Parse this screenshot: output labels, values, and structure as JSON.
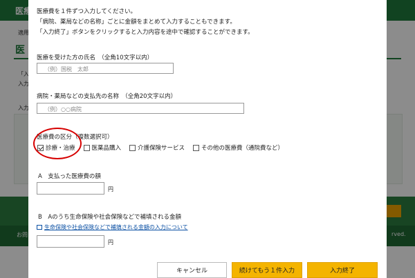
{
  "background": {
    "header_title": "医療",
    "line1": "適用",
    "title": "医",
    "text1": "「入",
    "text2": "入力",
    "text3": "入力",
    "footer_left": "お問",
    "footer_right": "rved."
  },
  "modal": {
    "intro": [
      "医療費を１件ずつ入力してください。",
      "「病院、薬局などの名称」ごとに金額をまとめて入力することもできます。",
      "「入力終了」ボタンをクリックすると入力内容を途中で確認することができます。"
    ],
    "name_label": "医療を受けた方の氏名　（全角10文字以内）",
    "name_placeholder": "（例）国税　太郎",
    "payee_label": "病院・薬局などの支払先の名称　（全角20文字以内）",
    "payee_placeholder": "（例）○○病院",
    "category_label": "医療費の区分（複数選択可）",
    "categories": [
      {
        "label": "診療・治療",
        "checked": true
      },
      {
        "label": "医薬品購入",
        "checked": false
      },
      {
        "label": "介護保険サービス",
        "checked": false
      },
      {
        "label": "その他の医療費（通院費など）",
        "checked": false
      }
    ],
    "amount_a_label": "A　支払った医療費の額",
    "amount_a_unit": "円",
    "amount_b_label": "B　Aのうち生命保険や社会保険などで補填される金額",
    "amount_b_link": "生命保険や社会保険などで補填される金額の入力について",
    "amount_b_unit": "円",
    "buttons": {
      "cancel": "キャンセル",
      "continue": "続けてもう１件入力",
      "finish": "入力終了"
    }
  },
  "colors": {
    "brand_green": "#1f7a3c",
    "button_yellow": "#f4b400",
    "highlight_red": "#d60000",
    "link_blue": "#0a4fa3"
  }
}
